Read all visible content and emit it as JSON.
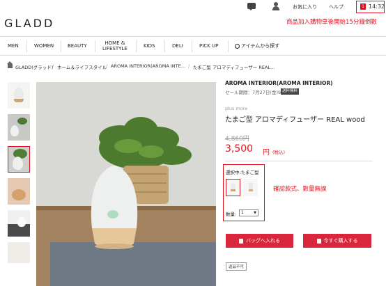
{
  "header": {
    "favorites": "お気に入り",
    "help": "ヘルプ",
    "timer": "14:32",
    "timer_note": "商品加入購物車後開始15分鐘倒數"
  },
  "logo": "GLADD",
  "nav": [
    {
      "label": "MEN"
    },
    {
      "label": "WOMEN"
    },
    {
      "label": "BEAUTY"
    },
    {
      "label": "HOME &\nLIFESTYLE"
    },
    {
      "label": "KIDS"
    },
    {
      "label": "DELI"
    },
    {
      "label": "PICK UP"
    },
    {
      "label": "アイテムから探す"
    }
  ],
  "breadcrumb": [
    "GLADD(グラッド)",
    "ホーム＆ライフスタイル",
    "AROMA INTERIOR(AROMA INTE…",
    "たまご型 アロマディフューザー REAL…"
  ],
  "product": {
    "brand_title": "AROMA INTERIOR(AROMA INTERIOR)",
    "sale_period": "セール期間：7月27日(金)9:00まで",
    "free_shipping": "送料無料",
    "sub_brand": "plus more",
    "name": "たまご型 アロマディフューザー REAL wood",
    "old_price": "4,860円",
    "price": "3,500",
    "price_unit": "円",
    "tax": "(税込)",
    "selected_label": "選択中:たまご型",
    "qty_label": "数量:",
    "qty_value": "1",
    "selection_note": "確認款式、數量無誤",
    "add_to_bag": "バッグへ入れる",
    "buy_now": "今すぐ購入する",
    "returnable": "返品不可"
  },
  "colors": {
    "accent": "#e0121f",
    "button": "#d9263c"
  }
}
